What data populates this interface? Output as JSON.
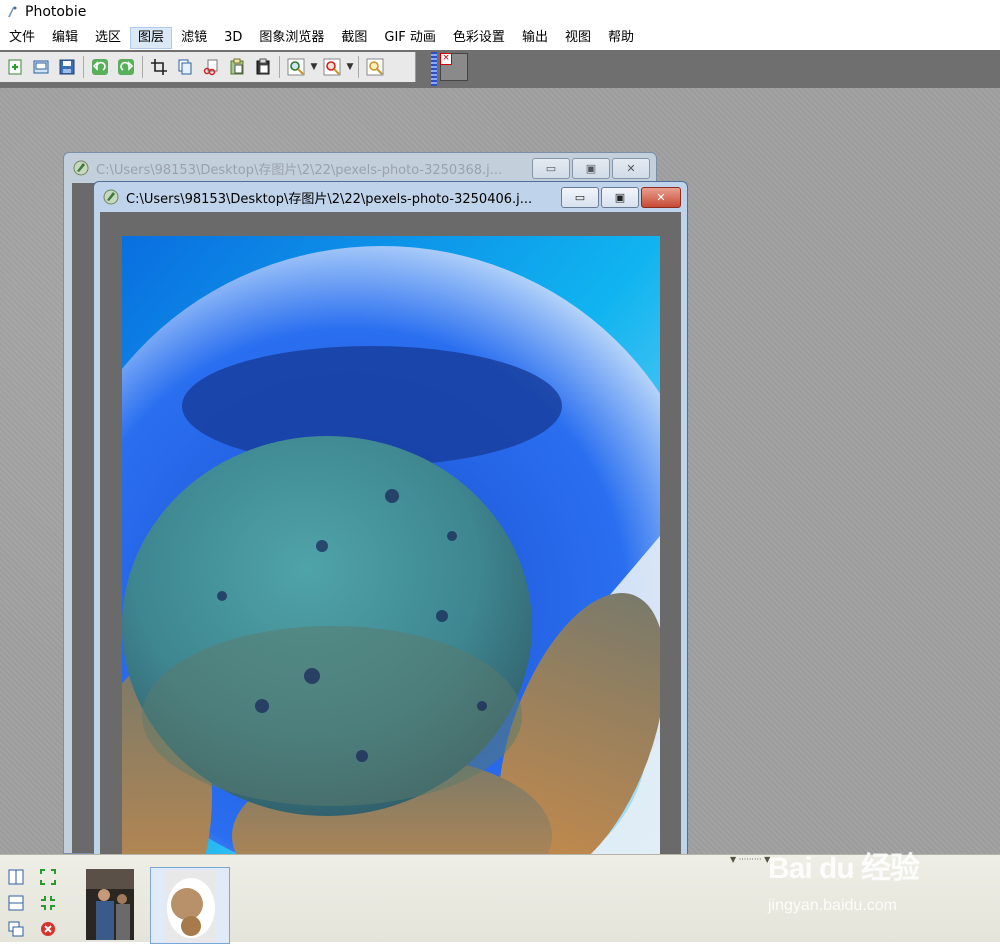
{
  "app": {
    "title": "Photobie"
  },
  "menu": [
    {
      "label": "文件"
    },
    {
      "label": "编辑"
    },
    {
      "label": "选区"
    },
    {
      "label": "图层",
      "active": true
    },
    {
      "label": "滤镜"
    },
    {
      "label": "3D"
    },
    {
      "label": "图象浏览器"
    },
    {
      "label": "截图"
    },
    {
      "label": "GIF 动画"
    },
    {
      "label": "色彩设置"
    },
    {
      "label": "输出"
    },
    {
      "label": "视图"
    },
    {
      "label": "帮助"
    }
  ],
  "toolbar": {
    "icons": [
      "new-icon",
      "open-icon",
      "save-icon",
      "undo-icon",
      "redo-icon",
      "crop-icon",
      "copy-icon",
      "cut-icon",
      "paste-icon",
      "paste-new-icon",
      "zoom-in-icon",
      "zoom-out-icon",
      "zoom-fit-icon"
    ]
  },
  "documents": {
    "back": {
      "title": "C:\\Users\\98153\\Desktop\\存图片\\2\\22\\pexels-photo-3250368.j..."
    },
    "front": {
      "title": "C:\\Users\\98153\\Desktop\\存图片\\2\\22\\pexels-photo-3250406.j..."
    }
  },
  "window_buttons": {
    "minimize": "▭",
    "restore": "▣",
    "close": "✕"
  },
  "watermark": {
    "logo": "Bai du 经验",
    "url": "jingyan.baidu.com"
  },
  "colors": {
    "workspace": "#a0a0a0",
    "menu_active_bg": "#dbe9f7",
    "close_red": "#c74a35"
  }
}
